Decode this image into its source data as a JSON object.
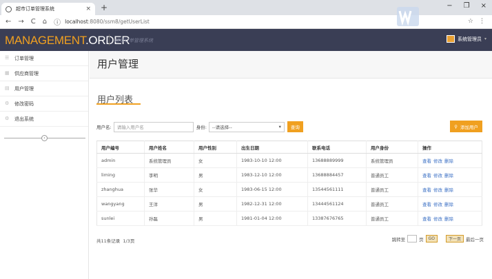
{
  "browser": {
    "tab_title": "超市订单管理系统",
    "tab_close": "×",
    "new_tab": "+",
    "url_host": "localhost",
    "url_path": ":8080/ssm8/getUserList",
    "win_min": "−",
    "win_max": "❐",
    "win_close": "×"
  },
  "header": {
    "logo_a": "MANAGEMENT",
    "logo_dot": ".",
    "logo_b": "ORDER",
    "subtitle": "超市订单管理系统",
    "user": "系统管理员"
  },
  "sidebar": {
    "items": [
      {
        "label": "订单管理"
      },
      {
        "label": "供应商管理"
      },
      {
        "label": "用户管理"
      },
      {
        "label": "修改密码"
      },
      {
        "label": "退出系统"
      }
    ]
  },
  "main": {
    "page_title": "用户管理",
    "section_title": "用户列表",
    "filter": {
      "name_label": "用户名:",
      "name_placeholder": "请输入用户名",
      "role_label": "身份:",
      "role_selected": "--请选择--",
      "query_button": "查询"
    },
    "add_button": "添加用户",
    "table": {
      "headers": [
        "用户编号",
        "用户姓名",
        "用户性别",
        "出生日期",
        "联系电话",
        "用户身份",
        "操作"
      ],
      "rows": [
        [
          "admin",
          "系统管理员",
          "女",
          "1983-10-10 12:00",
          "13688889999",
          "系统管理员"
        ],
        [
          "liming",
          "李明",
          "男",
          "1983-12-10 12:00",
          "13688884457",
          "普通员工"
        ],
        [
          "zhanghua",
          "张华",
          "女",
          "1983-06-15 12:00",
          "13544561111",
          "普通员工"
        ],
        [
          "wangyang",
          "王洋",
          "男",
          "1982-12-31 12:00",
          "13444561124",
          "普通员工"
        ],
        [
          "sunlei",
          "孙磊",
          "男",
          "1981-01-04 12:00",
          "13387676765",
          "普通员工"
        ]
      ],
      "actions": [
        "查看",
        "修改",
        "删除"
      ]
    },
    "pagination": {
      "summary": "共11条记录",
      "pages": "1/3页",
      "jump_label": "跳转至",
      "page_unit": "页",
      "go": "GO",
      "next": "下一页",
      "last": "最后一页"
    }
  }
}
